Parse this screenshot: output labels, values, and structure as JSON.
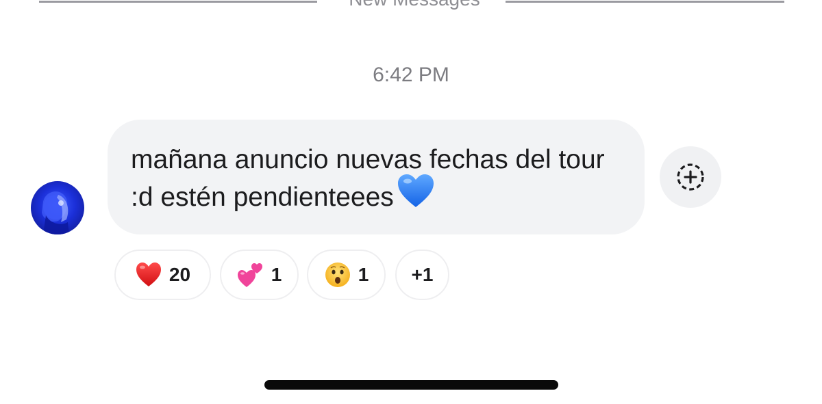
{
  "divider": {
    "label": "New Messages"
  },
  "timestamp": "6:42 PM",
  "message": {
    "text": "mañana anuncio nuevas fechas del tour :d estén pendienteees",
    "trailing_emoji": "blue-heart"
  },
  "reactions": [
    {
      "emoji": "red-heart",
      "count": "20"
    },
    {
      "emoji": "two-hearts",
      "count": "1"
    },
    {
      "emoji": "surprised-face",
      "count": "1"
    },
    {
      "emoji": "",
      "count": "+1"
    }
  ],
  "colors": {
    "bubble": "#f2f3f5",
    "text": "#1c1c1e",
    "timestamp": "#7c7c81",
    "divider": "#9a9aa0"
  },
  "icons": {
    "add_reaction": "add-reaction-icon"
  }
}
